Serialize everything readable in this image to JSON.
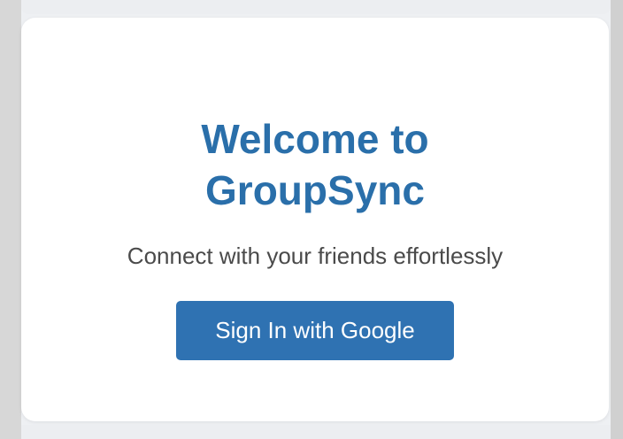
{
  "card": {
    "title_line1": "Welcome to",
    "title_line2": "GroupSync",
    "subtitle": "Connect with your friends effortlessly",
    "button_label": "Sign In with Google"
  },
  "colors": {
    "title": "#2a6faa",
    "button_background": "#2f72b2",
    "button_text": "#ffffff",
    "subtitle": "#4a4a4a",
    "card_background": "#ffffff",
    "surface_background": "#eef0f3"
  }
}
